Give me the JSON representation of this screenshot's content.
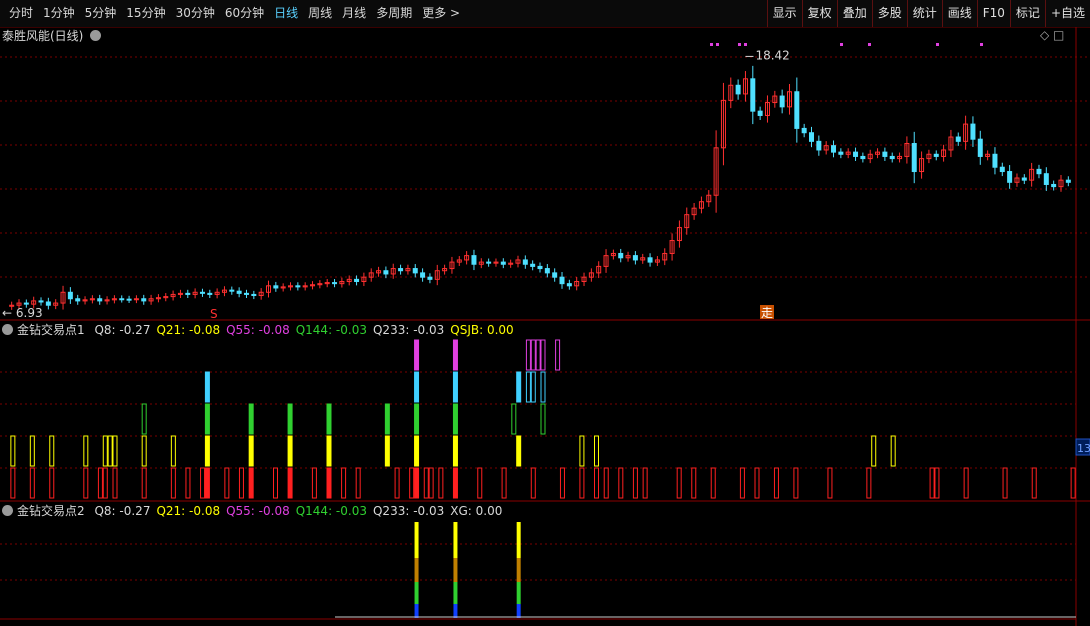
{
  "toolbar": {
    "periods": [
      "分时",
      "1分钟",
      "5分钟",
      "15分钟",
      "30分钟",
      "60分钟",
      "日线",
      "周线",
      "月线",
      "多周期",
      "更多 >"
    ],
    "active_period": "日线",
    "buttons": [
      "显示",
      "复权",
      "叠加",
      "多股",
      "统计",
      "画线",
      "F10",
      "标记",
      "+自选"
    ]
  },
  "main_panel": {
    "title": "泰胜风能(日线)",
    "high_label": "18.42",
    "low_label": "6.93",
    "marker_s": "S",
    "marker_zou": "走"
  },
  "indicator1": {
    "title": "金钻交易点1",
    "values": [
      {
        "text": "Q8: -0.27",
        "color": "#d8d8d8"
      },
      {
        "text": "Q21: -0.08",
        "color": "#ffff00"
      },
      {
        "text": "Q55: -0.08",
        "color": "#e040e0"
      },
      {
        "text": "Q144: -0.03",
        "color": "#30d030"
      },
      {
        "text": "Q233: -0.03",
        "color": "#d8d8d8"
      },
      {
        "text": "QSJB: 0.00",
        "color": "#ffff00"
      }
    ],
    "right_tag": "13"
  },
  "indicator2": {
    "title": "金钻交易点2",
    "values": [
      {
        "text": "Q8: -0.27",
        "color": "#d8d8d8"
      },
      {
        "text": "Q21: -0.08",
        "color": "#ffff00"
      },
      {
        "text": "Q55: -0.08",
        "color": "#e040e0"
      },
      {
        "text": "Q144: -0.03",
        "color": "#30d030"
      },
      {
        "text": "Q233: -0.03",
        "color": "#d8d8d8"
      },
      {
        "text": "XG: 0.00",
        "color": "#d8d8d8"
      }
    ]
  },
  "chart_data": {
    "type": "candlestick",
    "price_range": [
      6.5,
      19.3
    ],
    "colors": {
      "up": "#ff3030",
      "down": "#4fe0ff",
      "grid": "#7a0000"
    },
    "closes": [
      7.0,
      7.1,
      7.05,
      7.2,
      7.15,
      7.0,
      7.1,
      7.6,
      7.3,
      7.2,
      7.25,
      7.3,
      7.2,
      7.25,
      7.3,
      7.28,
      7.26,
      7.3,
      7.2,
      7.3,
      7.35,
      7.4,
      7.5,
      7.55,
      7.5,
      7.6,
      7.55,
      7.5,
      7.6,
      7.7,
      7.65,
      7.55,
      7.5,
      7.45,
      7.6,
      7.9,
      7.8,
      7.85,
      7.9,
      7.85,
      7.9,
      7.95,
      8.0,
      8.05,
      8.0,
      8.1,
      8.2,
      8.1,
      8.3,
      8.5,
      8.6,
      8.45,
      8.7,
      8.6,
      8.7,
      8.5,
      8.3,
      8.2,
      8.6,
      8.7,
      9.0,
      9.1,
      9.3,
      8.9,
      9.0,
      8.95,
      9.0,
      8.9,
      8.95,
      9.1,
      8.9,
      8.8,
      8.7,
      8.5,
      8.3,
      8.0,
      7.9,
      8.1,
      8.3,
      8.5,
      8.8,
      9.3,
      9.4,
      9.2,
      9.3,
      9.1,
      9.2,
      9.0,
      9.1,
      9.4,
      10.0,
      10.6,
      11.2,
      11.5,
      11.8,
      12.1,
      14.3,
      16.5,
      17.2,
      16.8,
      17.5,
      16.0,
      15.8,
      16.4,
      16.7,
      16.2,
      16.9,
      15.2,
      15.0,
      14.6,
      14.2,
      14.4,
      14.1,
      14.0,
      14.1,
      13.9,
      13.8,
      14.0,
      14.1,
      13.9,
      13.8,
      13.9,
      14.5,
      13.2,
      13.8,
      14.0,
      13.9,
      14.2,
      14.8,
      14.6,
      15.4,
      14.7,
      13.9,
      14.0,
      13.4,
      13.2,
      12.7,
      12.9,
      12.8,
      13.3,
      13.1,
      12.6,
      12.5,
      12.8,
      12.7
    ]
  },
  "signals": {
    "q8_red": [
      1,
      5,
      9,
      16,
      19,
      20,
      22,
      28,
      34,
      37,
      40,
      41,
      45,
      48,
      50,
      55,
      58,
      63,
      66,
      69,
      72,
      80,
      83,
      84,
      86,
      87,
      89,
      92,
      97,
      102,
      108,
      114,
      118,
      121,
      123,
      126,
      129,
      131,
      138,
      141,
      145,
      151,
      154,
      158,
      162,
      169,
      177,
      190,
      191,
      197,
      205,
      211,
      219
    ],
    "q21_yellow": [
      1,
      5,
      9,
      16,
      20,
      21,
      22,
      28,
      34,
      41,
      50,
      58,
      66,
      78,
      84,
      92,
      105,
      118,
      121,
      178,
      182
    ],
    "q144_green": [
      28,
      41,
      50,
      58,
      66,
      78,
      84,
      92,
      104,
      110
    ],
    "q55_cyan": [
      41,
      84,
      92,
      105,
      107,
      108,
      110
    ],
    "qsjb_magenta": [
      84,
      92,
      107,
      108,
      109,
      110,
      113
    ],
    "filled": [
      41,
      50,
      58,
      66,
      78,
      84,
      92,
      105
    ],
    "xg": [
      84,
      92,
      105
    ]
  }
}
